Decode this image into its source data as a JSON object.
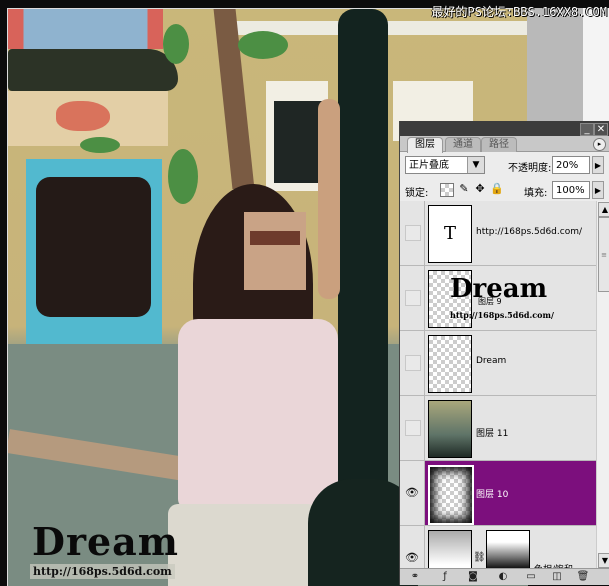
{
  "watermark": {
    "forum_banner": "最好的PS论坛:BBS.16XX8.COM",
    "dream_title": "Dream",
    "dream_url": "http://168ps.5d6d.com"
  },
  "layers_panel": {
    "window_buttons": {
      "minimize": "_",
      "close": "✕"
    },
    "tabs": [
      {
        "label": "图层",
        "active": true
      },
      {
        "label": "通道",
        "active": false
      },
      {
        "label": "路径",
        "active": false
      }
    ],
    "menu_button": "▸",
    "blend_mode": "正片叠底",
    "opacity_label": "不透明度:",
    "opacity_value": "20%",
    "lock_label": "锁定:",
    "fill_label": "填充:",
    "fill_value": "100%",
    "layers": [
      {
        "name": "http://168ps.5d6d.com/",
        "type": "text",
        "thumb_glyph": "T",
        "visible": false,
        "selected": false
      },
      {
        "name": "图层 9",
        "type": "pixel",
        "thumb_overlay_title": "Dream",
        "thumb_overlay_url": "http://168ps.5d6d.com/",
        "visible": false,
        "selected": false
      },
      {
        "name": "Dream",
        "type": "pixel",
        "visible": false,
        "selected": false
      },
      {
        "name": "图层 11",
        "type": "photo",
        "visible": false,
        "selected": false
      },
      {
        "name": "图层 10",
        "type": "pixel",
        "visible": true,
        "selected": true
      },
      {
        "name": "色相/饱和...",
        "type": "adjustment",
        "visible": true,
        "selected": false
      }
    ],
    "colors": {
      "selected_row": "#7c0f7d",
      "titlebar": "#3c3c3c"
    }
  }
}
